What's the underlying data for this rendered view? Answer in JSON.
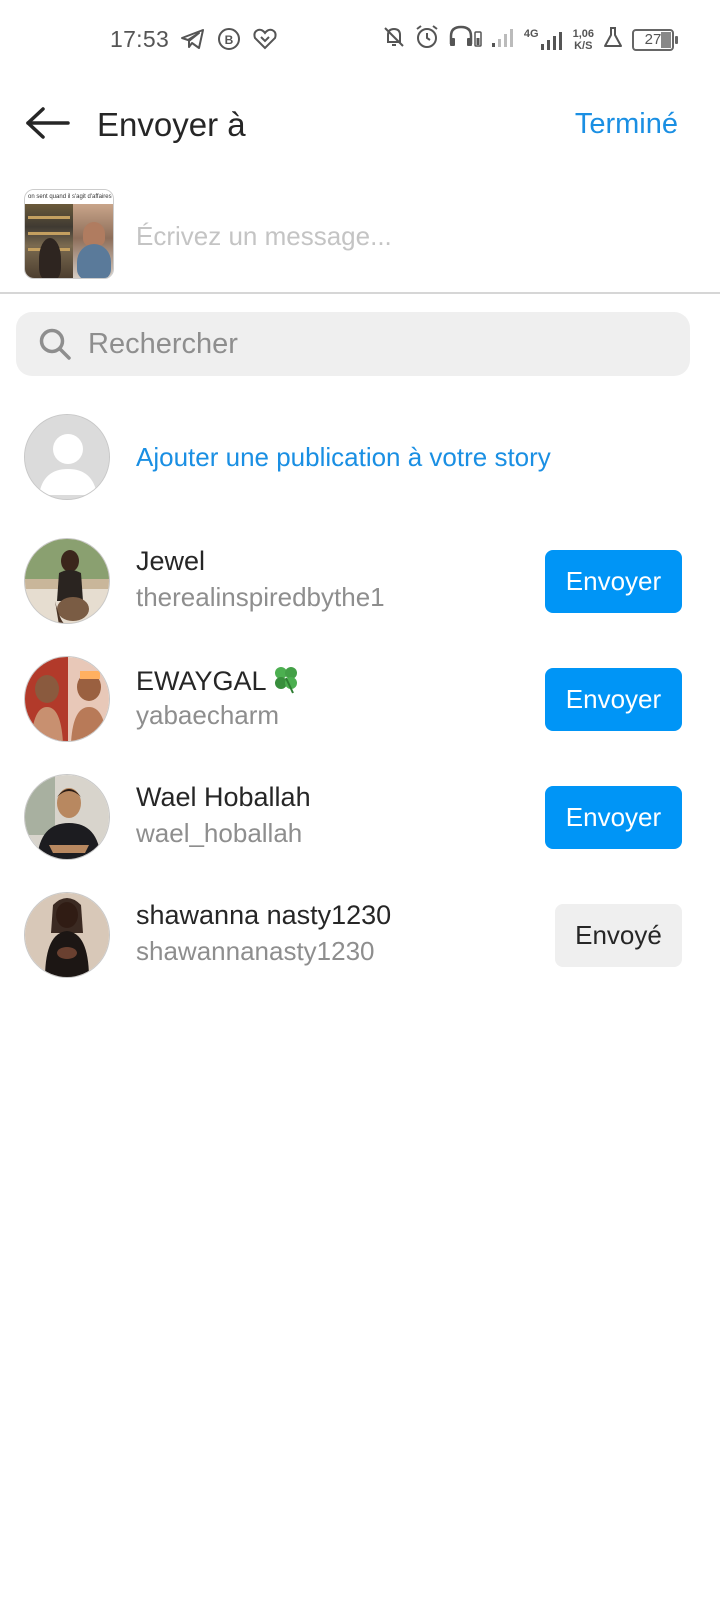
{
  "status_bar": {
    "time": "17:53",
    "speed_value": "1,06",
    "speed_unit": "K/S",
    "network": "4G",
    "battery": "27",
    "icons": [
      "telegram-icon",
      "whatsapp-business-icon",
      "heart-shield-icon",
      "mute-icon",
      "alarm-icon",
      "headphones-icon",
      "signal-icon",
      "lab-icon"
    ]
  },
  "header": {
    "title": "Envoyer à",
    "done_label": "Terminé"
  },
  "message": {
    "placeholder": "Écrivez un message...",
    "thumbnail_caption": "on sent quand il s'agit d'affaires"
  },
  "search": {
    "placeholder": "Rechercher"
  },
  "story": {
    "label": "Ajouter une publication à votre story"
  },
  "contacts": [
    {
      "name": "Jewel",
      "username": "therealinspiredbythe1",
      "action": "Envoyer",
      "status": "send"
    },
    {
      "name": "EWAYGAL",
      "username": "yabaecharm",
      "action": "Envoyer",
      "status": "send",
      "emoji": "clover-icon"
    },
    {
      "name": "Wael Hoballah",
      "username": "wael_hoballah",
      "action": "Envoyer",
      "status": "send"
    },
    {
      "name": "shawanna nasty1230",
      "username": "shawannanasty1230",
      "action": "Envoyé",
      "status": "sent"
    }
  ],
  "colors": {
    "accent": "#0095f6",
    "link": "#1a8fe3",
    "sent_bg": "#efefef",
    "secondary_text": "#8e8e8e"
  }
}
